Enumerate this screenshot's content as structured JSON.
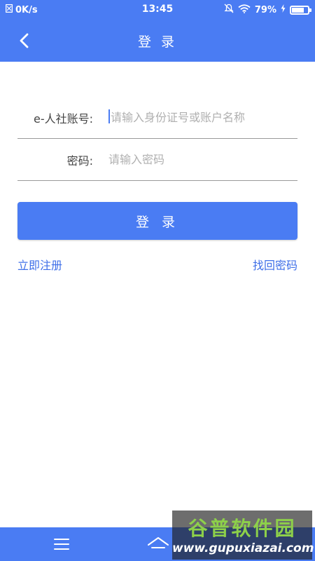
{
  "status_bar": {
    "network_speed": "0K/s",
    "time": "13:45",
    "battery_percent": "79%",
    "battery_level": 0.79
  },
  "header": {
    "title": "登 录"
  },
  "form": {
    "account_label": "e-人社账号:",
    "account_placeholder": "请输入身份证号或账户名称",
    "password_label": "密码:",
    "password_placeholder": "请输入密码"
  },
  "login_button": "登 录",
  "links": {
    "register": "立即注册",
    "forgot_password": "找回密码"
  },
  "watermark": {
    "brand": "谷普软件园",
    "url": "www.gupuxiazai.com"
  },
  "colors": {
    "primary": "#4a7cf3",
    "link": "#3f6fe8",
    "label": "#444444",
    "placeholder": "#b0b0b0"
  }
}
